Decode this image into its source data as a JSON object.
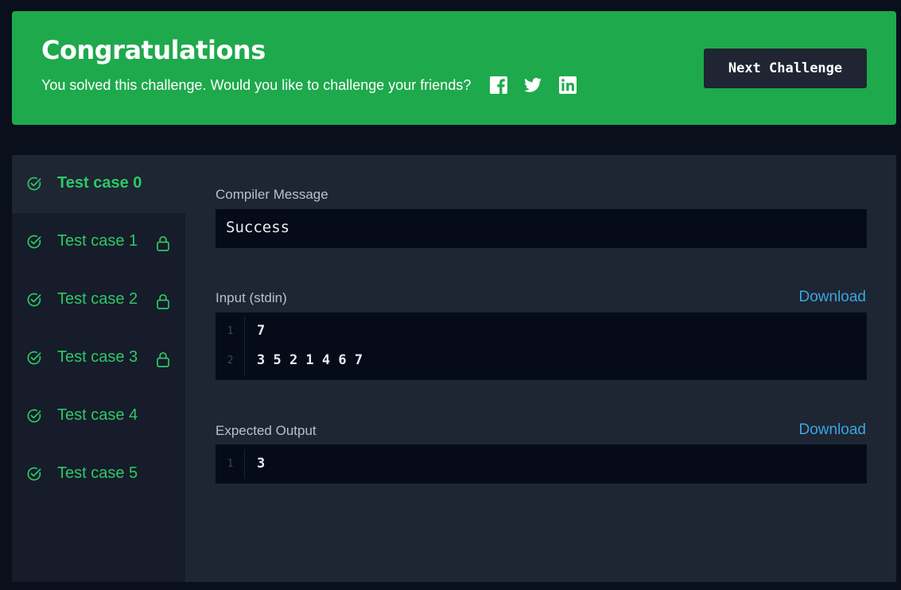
{
  "banner": {
    "title": "Congratulations",
    "subtitle": "You solved this challenge. Would you like to challenge your friends?",
    "social": [
      "facebook-icon",
      "twitter-icon",
      "linkedin-icon"
    ],
    "next_button": "Next Challenge",
    "color": "#1ea94c"
  },
  "test_cases": [
    {
      "label": "Test case 0",
      "locked": false,
      "active": true
    },
    {
      "label": "Test case 1",
      "locked": true,
      "active": false
    },
    {
      "label": "Test case 2",
      "locked": true,
      "active": false
    },
    {
      "label": "Test case 3",
      "locked": true,
      "active": false
    },
    {
      "label": "Test case 4",
      "locked": false,
      "active": false
    },
    {
      "label": "Test case 5",
      "locked": false,
      "active": false
    }
  ],
  "compiler": {
    "label": "Compiler Message",
    "message": "Success"
  },
  "input": {
    "label": "Input (stdin)",
    "download": "Download",
    "lines": [
      {
        "n": "1",
        "text": "7"
      },
      {
        "n": "2",
        "text": "3 5 2 1 4 6 7"
      }
    ]
  },
  "expected": {
    "label": "Expected Output",
    "download": "Download",
    "lines": [
      {
        "n": "1",
        "text": "3"
      }
    ]
  },
  "colors": {
    "success": "#2ec866",
    "link": "#39a7e0",
    "background": "#0a0f1c"
  }
}
